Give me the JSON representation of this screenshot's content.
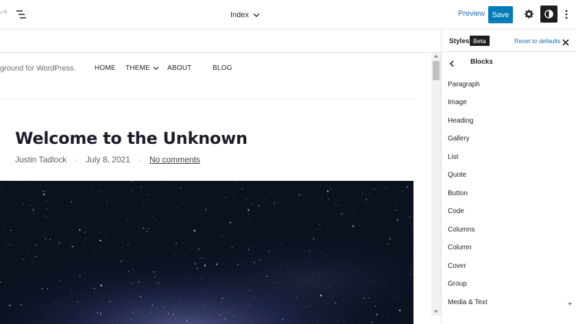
{
  "toolbar": {
    "document_title": "Index",
    "preview_label": "Preview",
    "save_label": "Save",
    "accent_color": "#007cba"
  },
  "canvas": {
    "site_tagline": "ground for WordPress.",
    "nav": {
      "home": "HOME",
      "theme": "THEME",
      "about": "ABOUT",
      "blog": "BLOG"
    },
    "post": {
      "title": "Welcome to the Unknown",
      "author": "Justin Tadlock",
      "separator": "·",
      "date": "July 8, 2021",
      "comments": "No comments",
      "image": "night-sky-stars"
    }
  },
  "sidebar": {
    "title": "Styles",
    "badge": "Beta",
    "reset_label": "Reset to defaults",
    "panel_title": "Blocks",
    "items": [
      "Paragraph",
      "Image",
      "Heading",
      "Gallery",
      "List",
      "Quote",
      "Button",
      "Code",
      "Columns",
      "Column",
      "Cover",
      "Group",
      "Media & Text"
    ]
  },
  "icons": {
    "redo": "redo-icon",
    "list_view": "list-view-icon",
    "chevron": "chevron-down-icon",
    "settings": "gear-icon",
    "styles": "half-circle-contrast-icon",
    "more": "more-vertical-icon",
    "close": "close-icon",
    "back": "chevron-left-icon"
  }
}
